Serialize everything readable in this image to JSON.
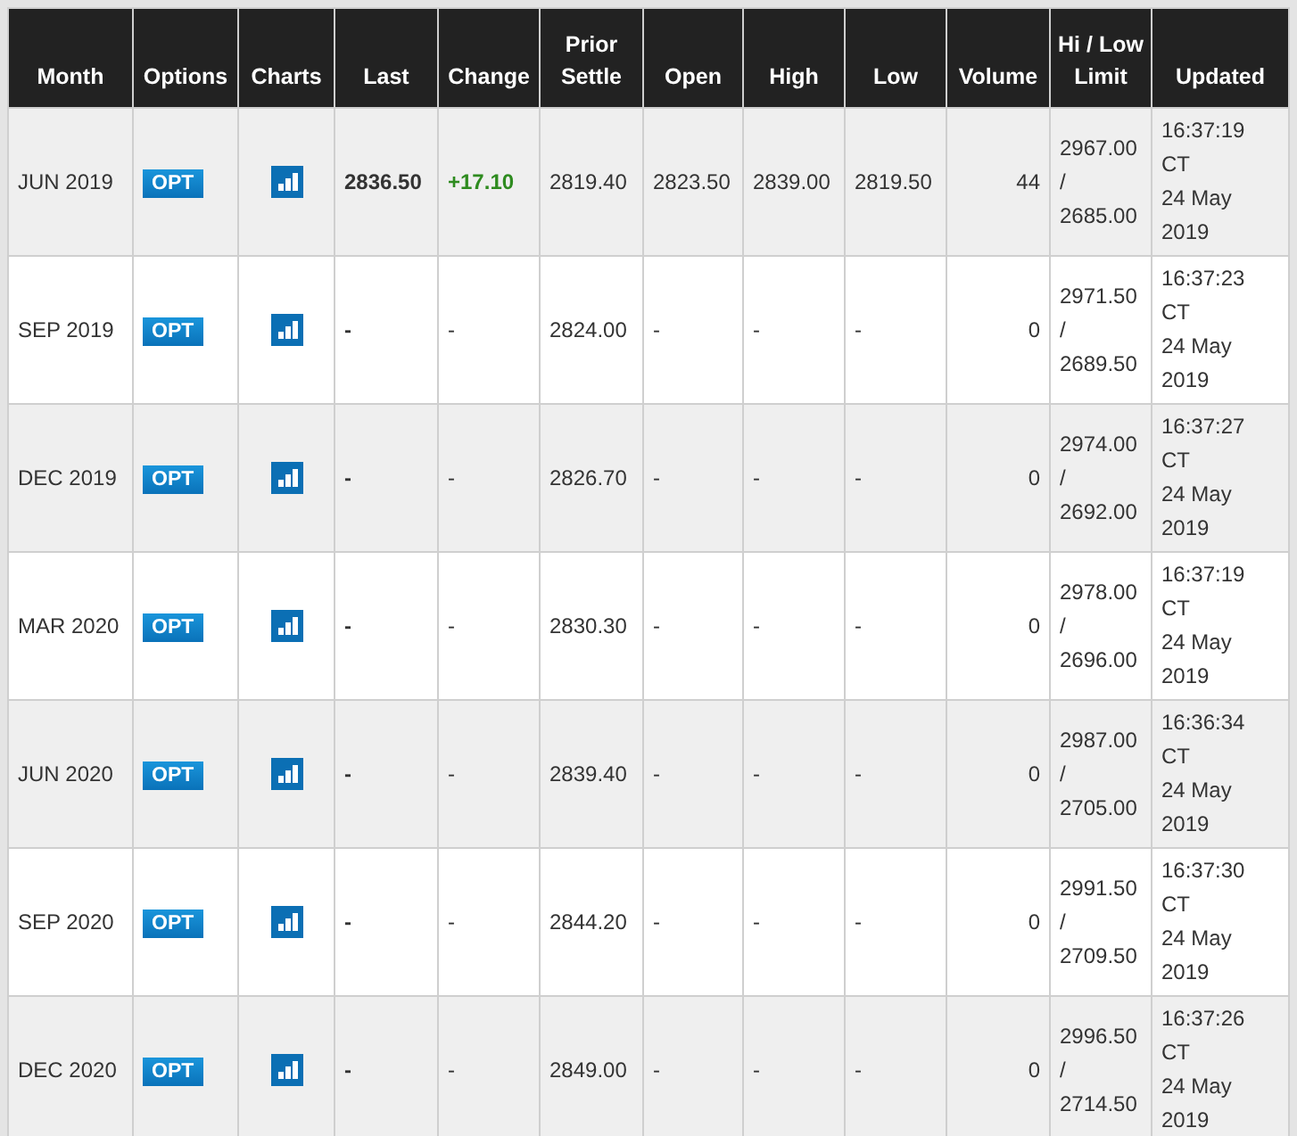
{
  "table": {
    "columns": [
      "Month",
      "Options",
      "Charts",
      "Last",
      "Change",
      "Prior Settle",
      "Open",
      "High",
      "Low",
      "Volume",
      "Hi / Low Limit",
      "Updated"
    ],
    "rows": [
      {
        "month": "JUN 2019",
        "options": "OPT",
        "last": "2836.50",
        "change": "+17.10",
        "rising": true,
        "prior_settle": "2819.40",
        "open": "2823.50",
        "high": "2839.00",
        "low": "2819.50",
        "volume": "44",
        "limit": "2967.00 / 2685.00",
        "updated_time": "16:37:19 CT",
        "updated_date": "24 May 2019"
      },
      {
        "month": "SEP 2019",
        "options": "OPT",
        "last": "-",
        "change": "-",
        "rising": false,
        "prior_settle": "2824.00",
        "open": "-",
        "high": "-",
        "low": "-",
        "volume": "0",
        "limit": "2971.50 / 2689.50",
        "updated_time": "16:37:23 CT",
        "updated_date": "24 May 2019"
      },
      {
        "month": "DEC 2019",
        "options": "OPT",
        "last": "-",
        "change": "-",
        "rising": false,
        "prior_settle": "2826.70",
        "open": "-",
        "high": "-",
        "low": "-",
        "volume": "0",
        "limit": "2974.00 / 2692.00",
        "updated_time": "16:37:27 CT",
        "updated_date": "24 May 2019"
      },
      {
        "month": "MAR 2020",
        "options": "OPT",
        "last": "-",
        "change": "-",
        "rising": false,
        "prior_settle": "2830.30",
        "open": "-",
        "high": "-",
        "low": "-",
        "volume": "0",
        "limit": "2978.00 / 2696.00",
        "updated_time": "16:37:19 CT",
        "updated_date": "24 May 2019"
      },
      {
        "month": "JUN 2020",
        "options": "OPT",
        "last": "-",
        "change": "-",
        "rising": false,
        "prior_settle": "2839.40",
        "open": "-",
        "high": "-",
        "low": "-",
        "volume": "0",
        "limit": "2987.00 / 2705.00",
        "updated_time": "16:36:34 CT",
        "updated_date": "24 May 2019"
      },
      {
        "month": "SEP 2020",
        "options": "OPT",
        "last": "-",
        "change": "-",
        "rising": false,
        "prior_settle": "2844.20",
        "open": "-",
        "high": "-",
        "low": "-",
        "volume": "0",
        "limit": "2991.50 / 2709.50",
        "updated_time": "16:37:30 CT",
        "updated_date": "24 May 2019"
      },
      {
        "month": "DEC 2020",
        "options": "OPT",
        "last": "-",
        "change": "-",
        "rising": false,
        "prior_settle": "2849.00",
        "open": "-",
        "high": "-",
        "low": "-",
        "volume": "0",
        "limit": "2996.50 / 2714.50",
        "updated_time": "16:37:26 CT",
        "updated_date": "24 May 2019"
      }
    ]
  }
}
